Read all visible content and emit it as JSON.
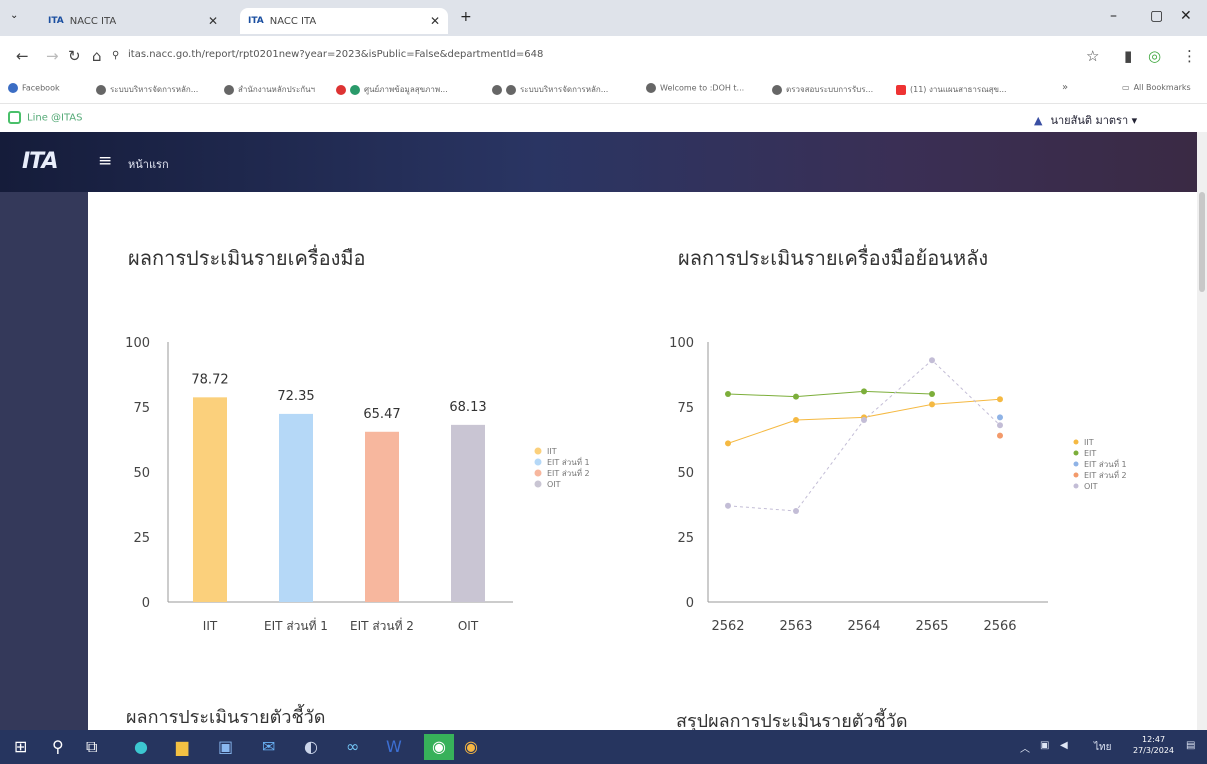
{
  "browser": {
    "tabs": [
      {
        "favicon": "ITA",
        "title": "NACC ITA"
      },
      {
        "favicon": "ITA",
        "title": "NACC ITA"
      }
    ],
    "new_tab": "+",
    "url": "itas.nacc.go.th/report/rpt0201new?year=2023&isPublic=False&departmentId=648",
    "bookmarks": [
      "Facebook",
      "ระบบบริหารจัดการหลัก...",
      "สำนักงานหลักประกันฯ",
      "ศูนย์ภาพข้อมูลสุขภาพ...",
      "ระบบบริหารจัดการหลัก...",
      "Welcome to :DOH t...",
      "ตรวจสอบระบบการรับร...",
      "(11) งานแผนสาธารณสุข..."
    ],
    "more_bookmarks": "»",
    "all_bookmarks": "All Bookmarks"
  },
  "topbar": {
    "line_link": "Line @ITAS",
    "user_name": "นายสันติ มาตรา ▾"
  },
  "app": {
    "logo": "ITA",
    "home_label": "หน้าแรก"
  },
  "sections": {
    "bar_title": "ผลการประเมินรายเครื่องมือ",
    "line_title": "ผลการประเมินรายเครื่องมือย้อนหลัง",
    "indicator_title": "ผลการประเมินรายตัวชี้วัด",
    "summary_title": "สรุปผลการประเมินรายตัวชี้วัด"
  },
  "chart_data": [
    {
      "type": "bar",
      "title": "ผลการประเมินรายเครื่องมือ",
      "categories": [
        "IIT",
        "EIT ส่วนที่ 1",
        "EIT ส่วนที่ 2",
        "OIT"
      ],
      "values": [
        78.72,
        72.35,
        65.47,
        68.13
      ],
      "data_labels": [
        "78.72",
        "72.35",
        "65.47",
        "68.13"
      ],
      "colors": [
        "#fbd07c",
        "#b5d8f7",
        "#f7b79e",
        "#c9c5d3"
      ],
      "legend": [
        "IIT",
        "EIT ส่วนที่ 1",
        "EIT ส่วนที่ 2",
        "OIT"
      ],
      "legend_position": "right",
      "yticks": [
        "0",
        "25",
        "50",
        "75",
        "100"
      ],
      "ylim": [
        0,
        100
      ]
    },
    {
      "type": "line",
      "title": "ผลการประเมินรายเครื่องมือย้อนหลัง",
      "x": [
        "2562",
        "2563",
        "2564",
        "2565",
        "2566"
      ],
      "yticks": [
        "0",
        "25",
        "50",
        "75",
        "100"
      ],
      "ylim": [
        0,
        100
      ],
      "legend_position": "right",
      "series": [
        {
          "name": "IIT",
          "color": "#f5b942",
          "values": [
            61,
            70,
            71,
            76,
            78
          ]
        },
        {
          "name": "EIT",
          "color": "#7cae3a",
          "values": [
            80,
            79,
            81,
            80,
            null
          ]
        },
        {
          "name": "EIT ส่วนที่ 1",
          "color": "#8fb3e6",
          "values": [
            null,
            null,
            null,
            null,
            71
          ]
        },
        {
          "name": "EIT ส่วนที่ 2",
          "color": "#f39a6b",
          "values": [
            null,
            null,
            null,
            null,
            64
          ]
        },
        {
          "name": "OIT",
          "color": "#c3bdd6",
          "values": [
            37,
            35,
            70,
            93,
            68
          ]
        }
      ]
    }
  ],
  "taskbar": {
    "time": "12:47",
    "date": "27/3/2024",
    "lang": "ไทย"
  }
}
